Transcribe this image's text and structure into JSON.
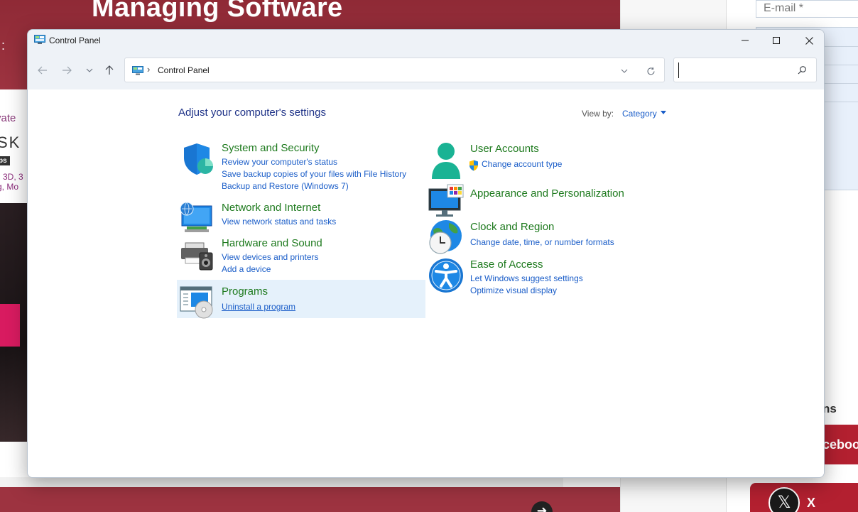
{
  "background_page": {
    "banner_title": "Managing Software",
    "banner_colon": ":",
    "left_text_1": "vate",
    "left_text_2": "SK",
    "left_text_3": "ps",
    "left_text_4": "3D, 3",
    "left_text_5": "g, Mo",
    "email_placeholder": "E-mail *",
    "right_label": "ns",
    "facebook_label": "ceboo",
    "x_symbol": "𝕏",
    "x_label": "X",
    "arrow_symbol": "➜"
  },
  "window": {
    "title": "Control Panel",
    "breadcrumb_separator": "›",
    "breadcrumb": "Control Panel",
    "search_value": ""
  },
  "content": {
    "heading": "Adjust your computer's settings",
    "view_by_label": "View by:",
    "view_by_value": "Category",
    "categories": {
      "system_security": {
        "title": "System and Security",
        "links": [
          "Review your computer's status",
          "Save backup copies of your files with File History",
          "Backup and Restore (Windows 7)"
        ]
      },
      "network_internet": {
        "title": "Network and Internet",
        "links": [
          "View network status and tasks"
        ]
      },
      "hardware_sound": {
        "title": "Hardware and Sound",
        "links": [
          "View devices and printers",
          "Add a device"
        ]
      },
      "programs": {
        "title": "Programs",
        "links": [
          "Uninstall a program"
        ]
      },
      "user_accounts": {
        "title": "User Accounts",
        "links": [
          "Change account type"
        ]
      },
      "appearance": {
        "title": "Appearance and Personalization",
        "links": []
      },
      "clock_region": {
        "title": "Clock and Region",
        "links": [
          "Change date, time, or number formats"
        ]
      },
      "ease_access": {
        "title": "Ease of Access",
        "links": [
          "Let Windows suggest settings",
          "Optimize visual display"
        ]
      }
    }
  },
  "colors": {
    "accent_link": "#1a5dc8",
    "category_title": "#1e7a1e",
    "heading": "#1e3287",
    "highlight": "#e5f1fb",
    "banner": "#9d3340"
  },
  "icons": {
    "system_security": "shield-icon",
    "network_internet": "network-monitor-icon",
    "hardware_sound": "printer-speaker-icon",
    "programs": "programs-disc-icon",
    "user_accounts": "user-icon",
    "appearance": "monitor-palette-icon",
    "clock_region": "globe-clock-icon",
    "ease_access": "accessibility-icon"
  }
}
